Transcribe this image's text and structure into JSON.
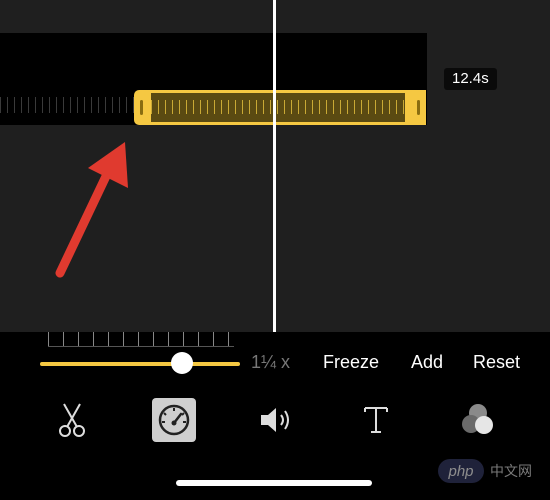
{
  "timeline": {
    "clip_duration": "12.4s"
  },
  "speed": {
    "value_label": "1¼ x",
    "level": 0.7
  },
  "actions": {
    "freeze": "Freeze",
    "add": "Add",
    "reset": "Reset"
  },
  "toolbar": {
    "icons": [
      "scissors-icon",
      "speedometer-icon",
      "speaker-icon",
      "text-icon",
      "filters-icon"
    ],
    "selected": "speedometer-icon"
  },
  "watermark": {
    "logo": "php",
    "text": "中文网"
  },
  "colors": {
    "accent": "#f5c842",
    "arrow": "#e03a2f",
    "timeline_bg": "#1f1f1f"
  }
}
